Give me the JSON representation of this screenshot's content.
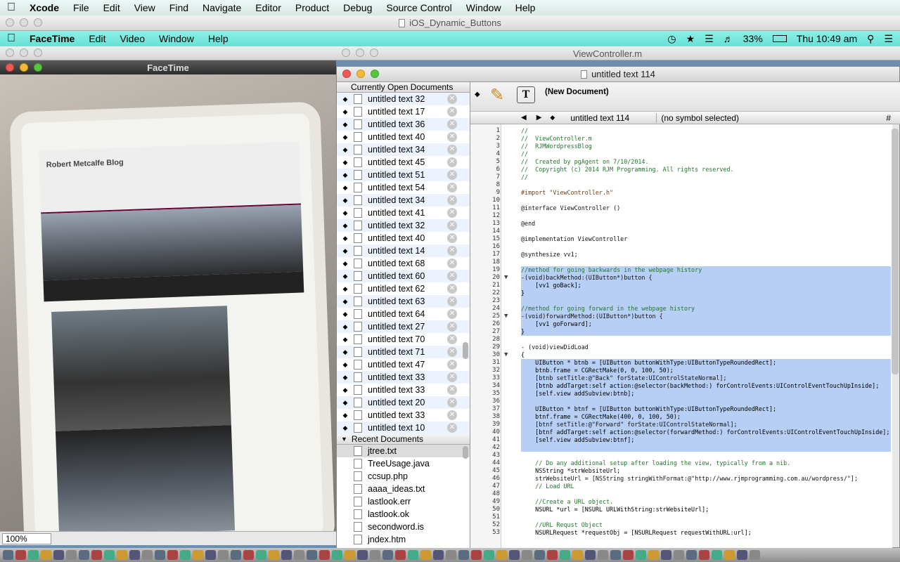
{
  "xcode_menu": {
    "app": "Xcode",
    "items": [
      "File",
      "Edit",
      "View",
      "Find",
      "Navigate",
      "Editor",
      "Product",
      "Debug",
      "Source Control",
      "Window",
      "Help"
    ]
  },
  "xcode_window_title": "iOS_Dynamic_Buttons",
  "facetime_menu": {
    "app": "FaceTime",
    "items": [
      "Edit",
      "Video",
      "Window",
      "Help"
    ],
    "status": {
      "battery": "33%",
      "clock": "Thu 10:49 am"
    }
  },
  "viewcontroller_window_title": "ViewController.m",
  "facetime_window": {
    "title": "FaceTime",
    "blog_title": "Robert Metcalfe Blog",
    "zoom": "100%"
  },
  "editor_window": {
    "title": "untitled text 114",
    "new_document_label": "(New Document)",
    "jump_document": "untitled text 114",
    "jump_symbol": "(no symbol selected)"
  },
  "open_documents": {
    "header": "Currently Open Documents",
    "items": [
      "untitled text 32",
      "untitled text 17",
      "untitled text 36",
      "untitled text 40",
      "untitled text 34",
      "untitled text 45",
      "untitled text 51",
      "untitled text 54",
      "untitled text 34",
      "untitled text 41",
      "untitled text 32",
      "untitled text 40",
      "untitled text 14",
      "untitled text 68",
      "untitled text 60",
      "untitled text 62",
      "untitled text 63",
      "untitled text 64",
      "untitled text 27",
      "untitled text 70",
      "untitled text 71",
      "untitled text 47",
      "untitled text 33",
      "untitled text 33",
      "untitled text 20",
      "untitled text 33",
      "untitled text 10"
    ]
  },
  "recent_documents": {
    "header": "Recent Documents",
    "items": [
      "jtree.txt",
      "TreeUsage.java",
      "ccsup.php",
      "aaaa_ideas.txt",
      "lastlook.err",
      "lastlook.ok",
      "secondword.is",
      "jndex.htm"
    ]
  },
  "code_lines": [
    "//",
    "//  ViewController.m",
    "//  RJMWordpressBlog",
    "//",
    "//  Created by pgAgent on 7/10/2014.",
    "//  Copyright (c) 2014 RJM Programming. All rights reserved.",
    "//",
    "",
    "#import \"ViewController.h\"",
    "",
    "@interface ViewController ()",
    "",
    "@end",
    "",
    "@implementation ViewController",
    "",
    "@synthesize vv1;",
    "",
    "//method for going backwards in the webpage history",
    "-(void)backMethod:(UIButton*)button {",
    "    [vv1 goBack];",
    "}",
    "",
    "//method for going forward in the webpage history",
    "-(void)forwardMethod:(UIButton*)button {",
    "    [vv1 goForward];",
    "}",
    "",
    "- (void)viewDidLoad",
    "{",
    "    UIButton * btnb = [UIButton buttonWithType:UIButtonTypeRoundedRect];",
    "    btnb.frame = CGRectMake(0, 0, 100, 50);",
    "    [btnb setTitle:@\"Back\" forState:UIControlStateNormal];",
    "    [btnb addTarget:self action:@selector(backMethod:) forControlEvents:UIControlEventTouchUpInside];",
    "    [self.view addSubview:btnb];",
    "",
    "    UIButton * btnf = [UIButton buttonWithType:UIButtonTypeRoundedRect];",
    "    btnf.frame = CGRectMake(400, 0, 100, 50);",
    "    [btnf setTitle:@\"Forward\" forState:UIControlStateNormal];",
    "    [btnf addTarget:self action:@selector(forwardMethod:) forControlEvents:UIControlEventTouchUpInside];",
    "    [self.view addSubview:btnf];",
    "",
    "",
    "    // Do any additional setup after loading the view, typically from a nib.",
    "    NSString *strWebsiteUrl;",
    "    strWebsiteUrl = [NSString stringWithFormat:@\"http://www.rjmprogramming.com.au/wordpress/\"];",
    "    // Load URL",
    "",
    "    //Create a URL object.",
    "    NSURL *url = [NSURL URLWithString:strWebsiteUrl];",
    "",
    "    //URL Requst Object",
    "    NSURLRequest *requestObj = [NSURLRequest requestWithURL:url];"
  ],
  "highlight_ranges": [
    [
      19,
      27
    ],
    [
      31,
      42
    ]
  ],
  "fold_lines": [
    20,
    25,
    30
  ],
  "colors": {
    "selection": "#b7cff5",
    "keyword": "#a20f87",
    "string": "#c41a16",
    "menubar_facetime": "#66e0d6"
  },
  "icons": [
    "apple-icon",
    "time-machine-icon",
    "bluetooth-icon",
    "wifi-icon",
    "volume-icon",
    "battery-icon",
    "spotlight-icon",
    "list-icon",
    "pencil-icon",
    "text-tool-icon",
    "close-icon",
    "document-icon"
  ]
}
